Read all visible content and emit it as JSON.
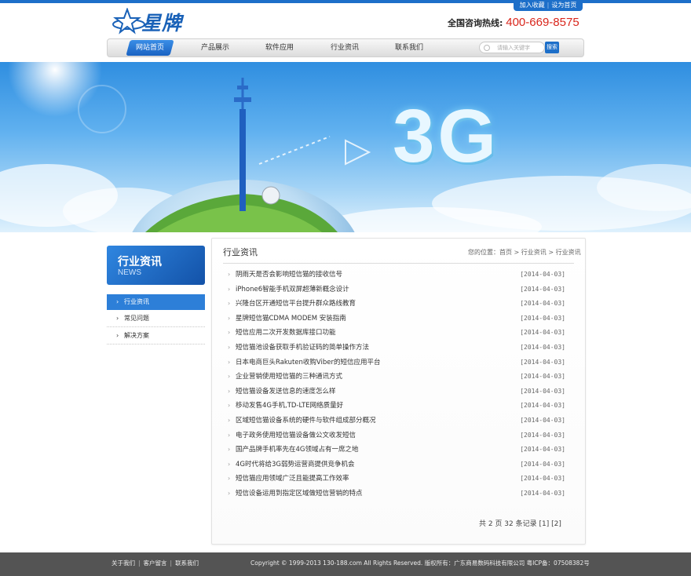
{
  "top_links": {
    "favorite": "加入收藏",
    "homepage": "设为首页"
  },
  "brand": {
    "name": "星牌"
  },
  "hotline": {
    "label": "全国咨询热线:",
    "number": "400-669-8575"
  },
  "nav": {
    "items": [
      {
        "label": "网站首页",
        "active": true
      },
      {
        "label": "产品展示"
      },
      {
        "label": "软件应用"
      },
      {
        "label": "行业资讯"
      },
      {
        "label": "联系我们"
      }
    ]
  },
  "search": {
    "placeholder": "请输入关键字",
    "button": "搜索"
  },
  "banner": {
    "headline": "3G"
  },
  "sidebar": {
    "title_cn": "行业资讯",
    "title_en": "NEWS",
    "items": [
      {
        "label": "行业资讯",
        "active": true
      },
      {
        "label": "常见问题"
      },
      {
        "label": "解决方案"
      }
    ]
  },
  "main": {
    "title": "行业资讯",
    "breadcrumb": "您的位置：首页 > 行业资讯 > 行业资讯",
    "articles": [
      {
        "title": "阴雨天是否会影响短信猫的接收信号",
        "date": "[2014-04-03]"
      },
      {
        "title": "iPhone6智能手机双屏超薄新概念设计",
        "date": "[2014-04-03]"
      },
      {
        "title": "兴隆台区开通短信平台提升群众路线教育",
        "date": "[2014-04-03]"
      },
      {
        "title": "星牌短信猫CDMA MODEM 安装指南",
        "date": "[2014-04-03]"
      },
      {
        "title": "短信应用二次开发数据库接口功能",
        "date": "[2014-04-03]"
      },
      {
        "title": "短信猫池设备获取手机验证码的简单操作方法",
        "date": "[2014-04-03]"
      },
      {
        "title": "日本电商巨头Rakuten收购Viber的短信应用平台",
        "date": "[2014-04-03]"
      },
      {
        "title": "企业营销使用短信猫的三种通讯方式",
        "date": "[2014-04-03]"
      },
      {
        "title": "短信猫设备发送信息的速度怎么样",
        "date": "[2014-04-03]"
      },
      {
        "title": "移动发售4G手机,TD-LTE网络质量好",
        "date": "[2014-04-03]"
      },
      {
        "title": "区域短信猫设备系统的硬件与软件组成部分概况",
        "date": "[2014-04-03]"
      },
      {
        "title": "电子政务使用短信猫设备做公文收发短信",
        "date": "[2014-04-03]"
      },
      {
        "title": "国产品牌手机率先在4G领域占有一席之地",
        "date": "[2014-04-03]"
      },
      {
        "title": "4G时代将给3G弱势运营商提供竞争机会",
        "date": "[2014-04-03]"
      },
      {
        "title": "短信猫应用领域广泛且能提高工作效率",
        "date": "[2014-04-03]"
      },
      {
        "title": "短信设备运用到指定区域做短信营销的特点",
        "date": "[2014-04-03]"
      }
    ],
    "pager": "共 2 页 32 条记录 [1] [2]"
  },
  "footer": {
    "links": [
      "关于我们",
      "客户留言",
      "联系我们"
    ],
    "copyright": "Copyright © 1999-2013 130-188.com All Rights Reserved.  版权所有：广东商易数码科技有限公司  粤ICP备：07508382号"
  },
  "colors": {
    "accent": "#1d6fc9",
    "hotline": "#d9261c",
    "footer": "#545454"
  }
}
